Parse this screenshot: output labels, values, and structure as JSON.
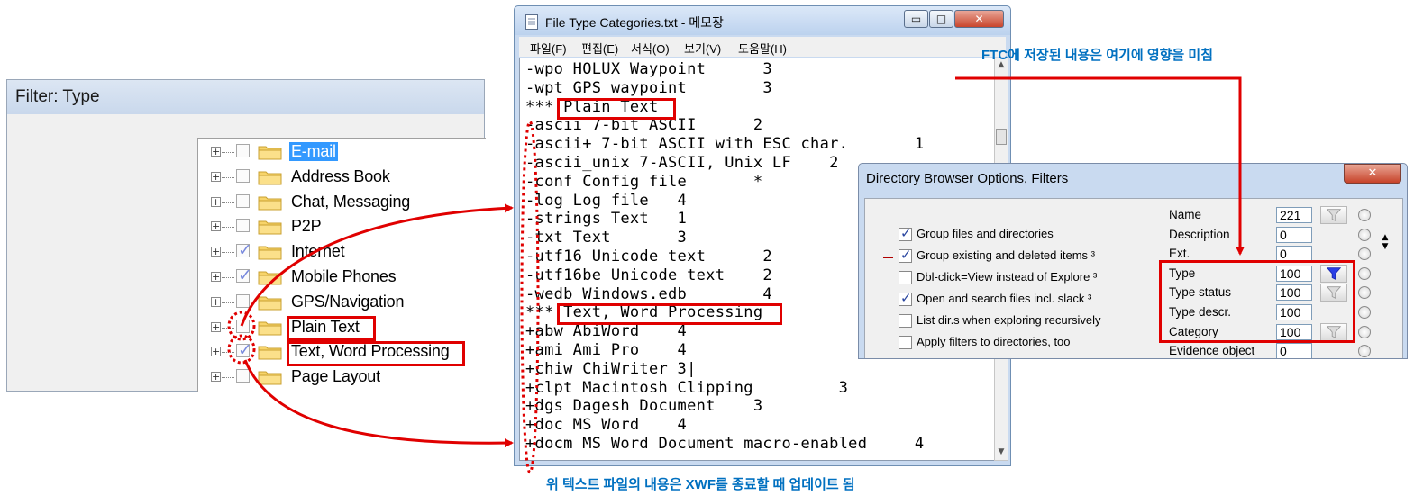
{
  "filter_panel": {
    "title": "Filter: Type",
    "items": [
      {
        "label": "E-mail",
        "checked": false,
        "selected": true
      },
      {
        "label": "Address Book",
        "checked": false,
        "selected": false
      },
      {
        "label": "Chat, Messaging",
        "checked": false,
        "selected": false
      },
      {
        "label": "P2P",
        "checked": false,
        "selected": false
      },
      {
        "label": "Internet",
        "checked": true,
        "selected": false
      },
      {
        "label": "Mobile Phones",
        "checked": true,
        "selected": false
      },
      {
        "label": "GPS/Navigation",
        "checked": false,
        "selected": false
      },
      {
        "label": "Plain Text",
        "checked": false,
        "selected": false
      },
      {
        "label": "Text, Word Processing",
        "checked": true,
        "selected": false
      },
      {
        "label": "Page Layout",
        "checked": false,
        "selected": false
      }
    ]
  },
  "notepad": {
    "title": "File Type Categories.txt - 메모장",
    "window_buttons": {
      "minimize": "▭",
      "maximize": "□",
      "close": "✕"
    },
    "menu": [
      "파일(F)",
      "편집(E)",
      "서식(O)",
      "보기(V)",
      "도움말(H)"
    ],
    "lines": [
      "-wpo HOLUX Waypoint      3",
      "-wpt GPS waypoint        3",
      "*** Plain Text",
      "-ascii 7-bit ASCII      2",
      "-ascii+ 7-bit ASCII with ESC char.       1",
      "-ascii_unix 7-ASCII, Unix LF    2",
      "-conf Config file       *",
      "-log Log file   4",
      "-strings Text   1",
      "-txt Text       3",
      "-utf16 Unicode text      2",
      "-utf16be Unicode text    2",
      "-wedb Windows.edb        4",
      "*** Text, Word Processing",
      "+abw AbiWord    4",
      "+ami Ami Pro    4",
      "+chiw ChiWriter 3|",
      "+clpt Macintosh Clipping         3",
      "+dgs Dagesh Document    3",
      "+doc MS Word    4",
      "+docm MS Word Document macro-enabled     4"
    ]
  },
  "dbo": {
    "title": "Directory Browser Options, Filters",
    "close_label": "✕",
    "options": [
      {
        "label": "Group files and directories",
        "checked": true
      },
      {
        "label": "Group existing and deleted items ³",
        "checked": true
      },
      {
        "label": "Dbl-click=View instead of Explore ³",
        "checked": false
      },
      {
        "label": "Open and search files incl. slack ³",
        "checked": true
      },
      {
        "label": "List dir.s when exploring recursively",
        "checked": false
      },
      {
        "label": "Apply filters to directories, too",
        "checked": false
      }
    ],
    "fields": [
      {
        "label": "Name",
        "value": "221",
        "funnel": "inactive"
      },
      {
        "label": "Description",
        "value": "0",
        "funnel": "none"
      },
      {
        "label": "Ext.",
        "value": "0",
        "funnel": "none"
      },
      {
        "label": "Type",
        "value": "100",
        "funnel": "active"
      },
      {
        "label": "Type status",
        "value": "100",
        "funnel": "inactive"
      },
      {
        "label": "Type descr.",
        "value": "100",
        "funnel": "none"
      },
      {
        "label": "Category",
        "value": "100",
        "funnel": "inactive"
      },
      {
        "label": "Evidence object",
        "value": "0",
        "funnel": "none"
      }
    ]
  },
  "annotations": {
    "top_right": "FTC에 저장된 내용은 여기에 영향을 미침",
    "bottom": "위 텍스트 파일의 내용은 XWF를 종료할 때 업데이트 됨"
  },
  "colors": {
    "highlight_red": "#e00000",
    "annotation_blue": "#0070c0",
    "selection_blue": "#3399ff"
  }
}
